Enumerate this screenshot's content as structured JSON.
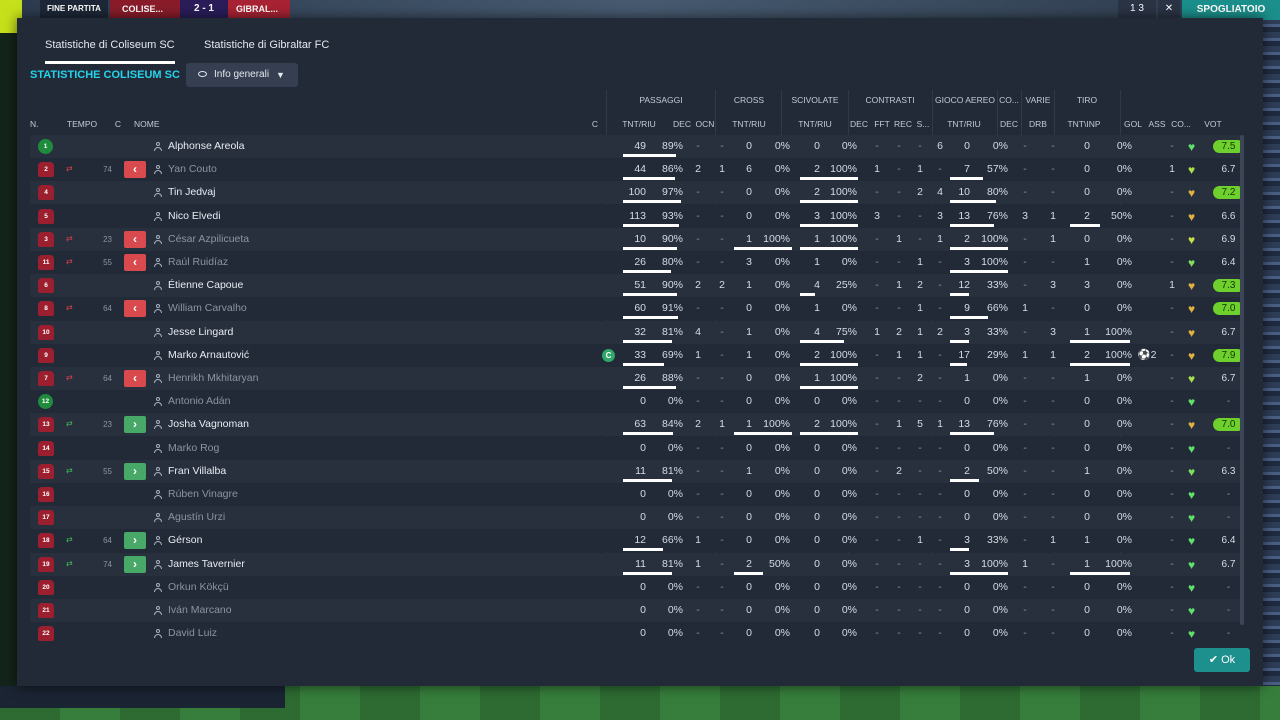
{
  "topbar": {
    "full_time": "FINE PARTITA",
    "home": "COLISE...",
    "score": "2 - 1",
    "away": "GIBRAL...",
    "subs_count": "1 3",
    "close": "✕",
    "locker_room": "SPOGLIATOIO"
  },
  "tabs": [
    "Statistiche di Coliseum SC",
    "Statistiche di Gibraltar FC"
  ],
  "section_title": "STATISTICHE COLISEUM SC",
  "view_dropdown": "Info generali",
  "groups": [
    "PASSAGGI",
    "CROSS",
    "SCIVOLATE",
    "CONTRASTI",
    "GIOCO AEREO",
    "CO...",
    "VARIE",
    "TIRO"
  ],
  "headers": {
    "n": "N.",
    "time": "TEMPO",
    "c": "C",
    "name": "NOME",
    "c2": "C",
    "pass_tnt": "TNT/RIU",
    "pass_dec": "DEC",
    "pass_ocn": "OCN",
    "cross_tnt": "TNT/RIU",
    "slide_tnt": "TNT/RIU",
    "tack_dec": "DEC",
    "tack_fft": "FFT",
    "tack_rec": "REC",
    "tack_s": "S...",
    "air_tnt": "TNT/RIU",
    "co_dec": "DEC",
    "var_drb": "DRB",
    "shot": "TNT\\INP",
    "gol": "GOL",
    "ass": "ASS",
    "cond": "CO...",
    "vot": "VOT"
  },
  "colors": {
    "accent": "#24d4ec",
    "rating_high": "#6ed02d",
    "sub_off": "#d84a4d",
    "sub_on": "#48a867"
  },
  "players": [
    {
      "no": "1",
      "gk": true,
      "time": "",
      "sub": "",
      "name": "Alphonse Areola",
      "muted": false,
      "cap": "",
      "pt": "49",
      "pp": "89%",
      "pdec": "-",
      "pocn": "-",
      "ct": "0",
      "cp": "0%",
      "st": "0",
      "sp": "0%",
      "tdec": "-",
      "tfft": "-",
      "trec": "-",
      "ts": "6",
      "at": "0",
      "ap": "0%",
      "codec": "-",
      "drb": "-",
      "sh": "0",
      "shp": "0%",
      "gol": "",
      "ass": "-",
      "heart": "#5fe06a",
      "vot": "7.5",
      "vclass": "hi",
      "pf": 0.89,
      "cf": 0,
      "sf": 0,
      "af": 0,
      "shf": 0
    },
    {
      "no": "2",
      "gk": false,
      "time": "74",
      "sub": "off",
      "name": "Yan Couto",
      "muted": true,
      "cap": "",
      "pt": "44",
      "pp": "86%",
      "pdec": "2",
      "pocn": "1",
      "ct": "6",
      "cp": "0%",
      "st": "2",
      "sp": "100%",
      "tdec": "1",
      "tfft": "-",
      "trec": "1",
      "ts": "-",
      "at": "7",
      "ap": "57%",
      "codec": "-",
      "drb": "-",
      "sh": "0",
      "shp": "0%",
      "gol": "",
      "ass": "1",
      "heart": "#a8e04a",
      "vot": "6.7",
      "vclass": "mid",
      "pf": 0.86,
      "cf": 0,
      "sf": 1,
      "af": 0.57,
      "shf": 0
    },
    {
      "no": "4",
      "gk": false,
      "time": "",
      "sub": "",
      "name": "Tin Jedvaj",
      "muted": false,
      "cap": "",
      "pt": "100",
      "pp": "97%",
      "pdec": "-",
      "pocn": "-",
      "ct": "0",
      "cp": "0%",
      "st": "2",
      "sp": "100%",
      "tdec": "-",
      "tfft": "-",
      "trec": "2",
      "ts": "4",
      "at": "10",
      "ap": "80%",
      "codec": "-",
      "drb": "-",
      "sh": "0",
      "shp": "0%",
      "gol": "",
      "ass": "-",
      "heart": "#e0b040",
      "vot": "7.2",
      "vclass": "hi",
      "pf": 0.97,
      "cf": 0,
      "sf": 1,
      "af": 0.8,
      "shf": 0
    },
    {
      "no": "5",
      "gk": false,
      "time": "",
      "sub": "",
      "name": "Nico Elvedi",
      "muted": false,
      "cap": "",
      "pt": "113",
      "pp": "93%",
      "pdec": "-",
      "pocn": "-",
      "ct": "0",
      "cp": "0%",
      "st": "3",
      "sp": "100%",
      "tdec": "3",
      "tfft": "-",
      "trec": "-",
      "ts": "3",
      "at": "13",
      "ap": "76%",
      "codec": "3",
      "drb": "1",
      "sh": "2",
      "shp": "50%",
      "gol": "",
      "ass": "-",
      "heart": "#e0b040",
      "vot": "6.6",
      "vclass": "mid",
      "pf": 0.93,
      "cf": 0,
      "sf": 1,
      "af": 0.76,
      "shf": 0.5
    },
    {
      "no": "3",
      "gk": false,
      "time": "23",
      "sub": "off",
      "name": "César Azpilicueta",
      "muted": true,
      "cap": "",
      "pt": "10",
      "pp": "90%",
      "pdec": "-",
      "pocn": "-",
      "ct": "1",
      "cp": "100%",
      "st": "1",
      "sp": "100%",
      "tdec": "-",
      "tfft": "1",
      "trec": "-",
      "ts": "1",
      "at": "2",
      "ap": "100%",
      "codec": "-",
      "drb": "1",
      "sh": "0",
      "shp": "0%",
      "gol": "",
      "ass": "-",
      "heart": "#c8e04a",
      "vot": "6.9",
      "vclass": "mid",
      "pf": 0.9,
      "cf": 1,
      "sf": 1,
      "af": 1,
      "shf": 0
    },
    {
      "no": "11",
      "gk": false,
      "time": "55",
      "sub": "off",
      "name": "Raúl Ruidíaz",
      "muted": true,
      "cap": "",
      "pt": "26",
      "pp": "80%",
      "pdec": "-",
      "pocn": "-",
      "ct": "3",
      "cp": "0%",
      "st": "1",
      "sp": "0%",
      "tdec": "-",
      "tfft": "-",
      "trec": "1",
      "ts": "-",
      "at": "3",
      "ap": "100%",
      "codec": "-",
      "drb": "-",
      "sh": "1",
      "shp": "0%",
      "gol": "",
      "ass": "-",
      "heart": "#7ee05a",
      "vot": "6.4",
      "vclass": "mid",
      "pf": 0.8,
      "cf": 0,
      "sf": 0,
      "af": 1,
      "shf": 0
    },
    {
      "no": "6",
      "gk": false,
      "time": "",
      "sub": "",
      "name": "Étienne Capoue",
      "muted": false,
      "cap": "",
      "pt": "51",
      "pp": "90%",
      "pdec": "2",
      "pocn": "2",
      "ct": "1",
      "cp": "0%",
      "st": "4",
      "sp": "25%",
      "tdec": "-",
      "tfft": "1",
      "trec": "2",
      "ts": "-",
      "at": "12",
      "ap": "33%",
      "codec": "-",
      "drb": "3",
      "sh": "3",
      "shp": "0%",
      "gol": "",
      "ass": "1",
      "heart": "#e0b040",
      "vot": "7.3",
      "vclass": "hi",
      "pf": 0.9,
      "cf": 0,
      "sf": 0.25,
      "af": 0.33,
      "shf": 0
    },
    {
      "no": "8",
      "gk": false,
      "time": "64",
      "sub": "off",
      "name": "William Carvalho",
      "muted": true,
      "cap": "",
      "pt": "60",
      "pp": "91%",
      "pdec": "-",
      "pocn": "-",
      "ct": "0",
      "cp": "0%",
      "st": "1",
      "sp": "0%",
      "tdec": "-",
      "tfft": "-",
      "trec": "1",
      "ts": "-",
      "at": "9",
      "ap": "66%",
      "codec": "1",
      "drb": "-",
      "sh": "0",
      "shp": "0%",
      "gol": "",
      "ass": "-",
      "heart": "#e0b040",
      "vot": "7.0",
      "vclass": "hi",
      "pf": 0.91,
      "cf": 0,
      "sf": 0,
      "af": 0.66,
      "shf": 0
    },
    {
      "no": "10",
      "gk": false,
      "time": "",
      "sub": "",
      "name": "Jesse Lingard",
      "muted": false,
      "cap": "",
      "pt": "32",
      "pp": "81%",
      "pdec": "4",
      "pocn": "-",
      "ct": "1",
      "cp": "0%",
      "st": "4",
      "sp": "75%",
      "tdec": "1",
      "tfft": "2",
      "trec": "1",
      "ts": "2",
      "at": "3",
      "ap": "33%",
      "codec": "-",
      "drb": "3",
      "sh": "1",
      "shp": "100%",
      "gol": "",
      "ass": "-",
      "heart": "#e0b040",
      "vot": "6.7",
      "vclass": "mid",
      "pf": 0.81,
      "cf": 0,
      "sf": 0.75,
      "af": 0.33,
      "shf": 1
    },
    {
      "no": "9",
      "gk": false,
      "time": "",
      "sub": "",
      "name": "Marko Arnautović",
      "muted": false,
      "cap": "C",
      "pt": "33",
      "pp": "69%",
      "pdec": "1",
      "pocn": "-",
      "ct": "1",
      "cp": "0%",
      "st": "2",
      "sp": "100%",
      "tdec": "-",
      "tfft": "1",
      "trec": "1",
      "ts": "-",
      "at": "17",
      "ap": "29%",
      "codec": "1",
      "drb": "1",
      "sh": "2",
      "shp": "100%",
      "gol": "⚽2",
      "ass": "-",
      "heart": "#e0b040",
      "vot": "7.9",
      "vclass": "hi",
      "pf": 0.69,
      "cf": 0,
      "sf": 1,
      "af": 0.29,
      "shf": 1
    },
    {
      "no": "7",
      "gk": false,
      "time": "64",
      "sub": "off",
      "name": "Henrikh Mkhitaryan",
      "muted": true,
      "cap": "",
      "pt": "26",
      "pp": "88%",
      "pdec": "-",
      "pocn": "-",
      "ct": "0",
      "cp": "0%",
      "st": "1",
      "sp": "100%",
      "tdec": "-",
      "tfft": "-",
      "trec": "2",
      "ts": "-",
      "at": "1",
      "ap": "0%",
      "codec": "-",
      "drb": "-",
      "sh": "1",
      "shp": "0%",
      "gol": "",
      "ass": "-",
      "heart": "#a8e04a",
      "vot": "6.7",
      "vclass": "mid",
      "pf": 0.88,
      "cf": 0,
      "sf": 1,
      "af": 0,
      "shf": 0
    },
    {
      "no": "12",
      "gk": true,
      "time": "",
      "sub": "",
      "name": "Antonio Adán",
      "muted": true,
      "cap": "",
      "pt": "0",
      "pp": "0%",
      "pdec": "-",
      "pocn": "-",
      "ct": "0",
      "cp": "0%",
      "st": "0",
      "sp": "0%",
      "tdec": "-",
      "tfft": "-",
      "trec": "-",
      "ts": "-",
      "at": "0",
      "ap": "0%",
      "codec": "-",
      "drb": "-",
      "sh": "0",
      "shp": "0%",
      "gol": "",
      "ass": "-",
      "heart": "#5fe06a",
      "vot": "-",
      "vclass": "none",
      "pf": 0,
      "cf": 0,
      "sf": 0,
      "af": 0,
      "shf": 0
    },
    {
      "no": "13",
      "gk": false,
      "time": "23",
      "sub": "on",
      "name": "Josha Vagnoman",
      "muted": false,
      "cap": "",
      "pt": "63",
      "pp": "84%",
      "pdec": "2",
      "pocn": "1",
      "ct": "1",
      "cp": "100%",
      "st": "2",
      "sp": "100%",
      "tdec": "-",
      "tfft": "1",
      "trec": "5",
      "ts": "1",
      "at": "13",
      "ap": "76%",
      "codec": "-",
      "drb": "-",
      "sh": "0",
      "shp": "0%",
      "gol": "",
      "ass": "-",
      "heart": "#e0b040",
      "vot": "7.0",
      "vclass": "hi",
      "pf": 0.84,
      "cf": 1,
      "sf": 1,
      "af": 0.76,
      "shf": 0
    },
    {
      "no": "14",
      "gk": false,
      "time": "",
      "sub": "",
      "name": "Marko Rog",
      "muted": true,
      "cap": "",
      "pt": "0",
      "pp": "0%",
      "pdec": "-",
      "pocn": "-",
      "ct": "0",
      "cp": "0%",
      "st": "0",
      "sp": "0%",
      "tdec": "-",
      "tfft": "-",
      "trec": "-",
      "ts": "-",
      "at": "0",
      "ap": "0%",
      "codec": "-",
      "drb": "-",
      "sh": "0",
      "shp": "0%",
      "gol": "",
      "ass": "-",
      "heart": "#5fe06a",
      "vot": "-",
      "vclass": "none",
      "pf": 0,
      "cf": 0,
      "sf": 0,
      "af": 0,
      "shf": 0
    },
    {
      "no": "15",
      "gk": false,
      "time": "55",
      "sub": "on",
      "name": "Fran Villalba",
      "muted": false,
      "cap": "",
      "pt": "11",
      "pp": "81%",
      "pdec": "-",
      "pocn": "-",
      "ct": "1",
      "cp": "0%",
      "st": "0",
      "sp": "0%",
      "tdec": "-",
      "tfft": "2",
      "trec": "-",
      "ts": "-",
      "at": "2",
      "ap": "50%",
      "codec": "-",
      "drb": "-",
      "sh": "1",
      "shp": "0%",
      "gol": "",
      "ass": "-",
      "heart": "#7ee05a",
      "vot": "6.3",
      "vclass": "mid",
      "pf": 0.81,
      "cf": 0,
      "sf": 0,
      "af": 0.5,
      "shf": 0
    },
    {
      "no": "16",
      "gk": false,
      "time": "",
      "sub": "",
      "name": "Rúben Vinagre",
      "muted": true,
      "cap": "",
      "pt": "0",
      "pp": "0%",
      "pdec": "-",
      "pocn": "-",
      "ct": "0",
      "cp": "0%",
      "st": "0",
      "sp": "0%",
      "tdec": "-",
      "tfft": "-",
      "trec": "-",
      "ts": "-",
      "at": "0",
      "ap": "0%",
      "codec": "-",
      "drb": "-",
      "sh": "0",
      "shp": "0%",
      "gol": "",
      "ass": "-",
      "heart": "#5fe06a",
      "vot": "-",
      "vclass": "none",
      "pf": 0,
      "cf": 0,
      "sf": 0,
      "af": 0,
      "shf": 0
    },
    {
      "no": "17",
      "gk": false,
      "time": "",
      "sub": "",
      "name": "Agustín Urzi",
      "muted": true,
      "cap": "",
      "pt": "0",
      "pp": "0%",
      "pdec": "-",
      "pocn": "-",
      "ct": "0",
      "cp": "0%",
      "st": "0",
      "sp": "0%",
      "tdec": "-",
      "tfft": "-",
      "trec": "-",
      "ts": "-",
      "at": "0",
      "ap": "0%",
      "codec": "-",
      "drb": "-",
      "sh": "0",
      "shp": "0%",
      "gol": "",
      "ass": "-",
      "heart": "#5fe06a",
      "vot": "-",
      "vclass": "none",
      "pf": 0,
      "cf": 0,
      "sf": 0,
      "af": 0,
      "shf": 0
    },
    {
      "no": "18",
      "gk": false,
      "time": "64",
      "sub": "on",
      "name": "Gérson",
      "muted": false,
      "cap": "",
      "pt": "12",
      "pp": "66%",
      "pdec": "1",
      "pocn": "-",
      "ct": "0",
      "cp": "0%",
      "st": "0",
      "sp": "0%",
      "tdec": "-",
      "tfft": "-",
      "trec": "1",
      "ts": "-",
      "at": "3",
      "ap": "33%",
      "codec": "-",
      "drb": "1",
      "sh": "1",
      "shp": "0%",
      "gol": "",
      "ass": "-",
      "heart": "#5fe06a",
      "vot": "6.4",
      "vclass": "mid",
      "pf": 0.66,
      "cf": 0,
      "sf": 0,
      "af": 0.33,
      "shf": 0
    },
    {
      "no": "19",
      "gk": false,
      "time": "74",
      "sub": "on",
      "name": "James Tavernier",
      "muted": false,
      "cap": "",
      "pt": "11",
      "pp": "81%",
      "pdec": "1",
      "pocn": "-",
      "ct": "2",
      "cp": "50%",
      "st": "0",
      "sp": "0%",
      "tdec": "-",
      "tfft": "-",
      "trec": "-",
      "ts": "-",
      "at": "3",
      "ap": "100%",
      "codec": "1",
      "drb": "-",
      "sh": "1",
      "shp": "100%",
      "gol": "",
      "ass": "-",
      "heart": "#5fe06a",
      "vot": "6.7",
      "vclass": "mid",
      "pf": 0.81,
      "cf": 0.5,
      "sf": 0,
      "af": 1,
      "shf": 1
    },
    {
      "no": "20",
      "gk": false,
      "time": "",
      "sub": "",
      "name": "Orkun Kökçü",
      "muted": true,
      "cap": "",
      "pt": "0",
      "pp": "0%",
      "pdec": "-",
      "pocn": "-",
      "ct": "0",
      "cp": "0%",
      "st": "0",
      "sp": "0%",
      "tdec": "-",
      "tfft": "-",
      "trec": "-",
      "ts": "-",
      "at": "0",
      "ap": "0%",
      "codec": "-",
      "drb": "-",
      "sh": "0",
      "shp": "0%",
      "gol": "",
      "ass": "-",
      "heart": "#5fe06a",
      "vot": "-",
      "vclass": "none",
      "pf": 0,
      "cf": 0,
      "sf": 0,
      "af": 0,
      "shf": 0
    },
    {
      "no": "21",
      "gk": false,
      "time": "",
      "sub": "",
      "name": "Iván Marcano",
      "muted": true,
      "cap": "",
      "pt": "0",
      "pp": "0%",
      "pdec": "-",
      "pocn": "-",
      "ct": "0",
      "cp": "0%",
      "st": "0",
      "sp": "0%",
      "tdec": "-",
      "tfft": "-",
      "trec": "-",
      "ts": "-",
      "at": "0",
      "ap": "0%",
      "codec": "-",
      "drb": "-",
      "sh": "0",
      "shp": "0%",
      "gol": "",
      "ass": "-",
      "heart": "#5fe06a",
      "vot": "-",
      "vclass": "none",
      "pf": 0,
      "cf": 0,
      "sf": 0,
      "af": 0,
      "shf": 0
    },
    {
      "no": "22",
      "gk": false,
      "time": "",
      "sub": "",
      "name": "David Luiz",
      "muted": true,
      "cap": "",
      "pt": "0",
      "pp": "0%",
      "pdec": "-",
      "pocn": "-",
      "ct": "0",
      "cp": "0%",
      "st": "0",
      "sp": "0%",
      "tdec": "-",
      "tfft": "-",
      "trec": "-",
      "ts": "-",
      "at": "0",
      "ap": "0%",
      "codec": "-",
      "drb": "-",
      "sh": "0",
      "shp": "0%",
      "gol": "",
      "ass": "-",
      "heart": "#5fe06a",
      "vot": "-",
      "vclass": "none",
      "pf": 0,
      "cf": 0,
      "sf": 0,
      "af": 0,
      "shf": 0
    }
  ],
  "ok_button": "Ok"
}
